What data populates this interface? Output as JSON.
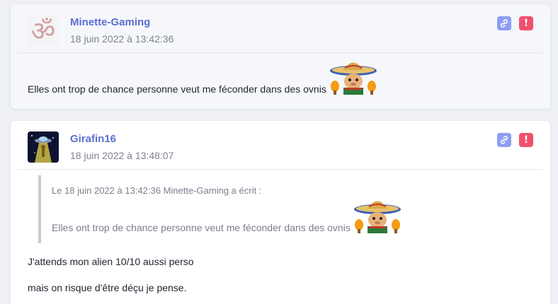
{
  "posts": [
    {
      "author": "Minette-Gaming",
      "date": "18 juin 2022 à 13:42:36",
      "avatar_icon": "om-symbol-icon",
      "message": "Elles ont trop de chance personne veut me féconder dans des ovnis",
      "sticker": "mexican-cat-sticker"
    },
    {
      "author": "Girafin16",
      "date": "18 juin 2022 à 13:48:07",
      "avatar_icon": "ufo-abduction-icon",
      "quote": {
        "header": "Le 18 juin 2022 à 13:42:36 Minette-Gaming a écrit :",
        "message": "Elles ont trop de chance personne veut me féconder dans des ovnis",
        "sticker": "mexican-cat-sticker"
      },
      "replies": [
        "J'attends mon alien 10/10 aussi perso",
        "mais on risque d'être déçu je pense."
      ]
    }
  ],
  "actions": {
    "alert_glyph": "!"
  },
  "colors": {
    "author": "#5c6fd0",
    "link_button": "#8e9df2",
    "alert_button": "#f0506e"
  }
}
